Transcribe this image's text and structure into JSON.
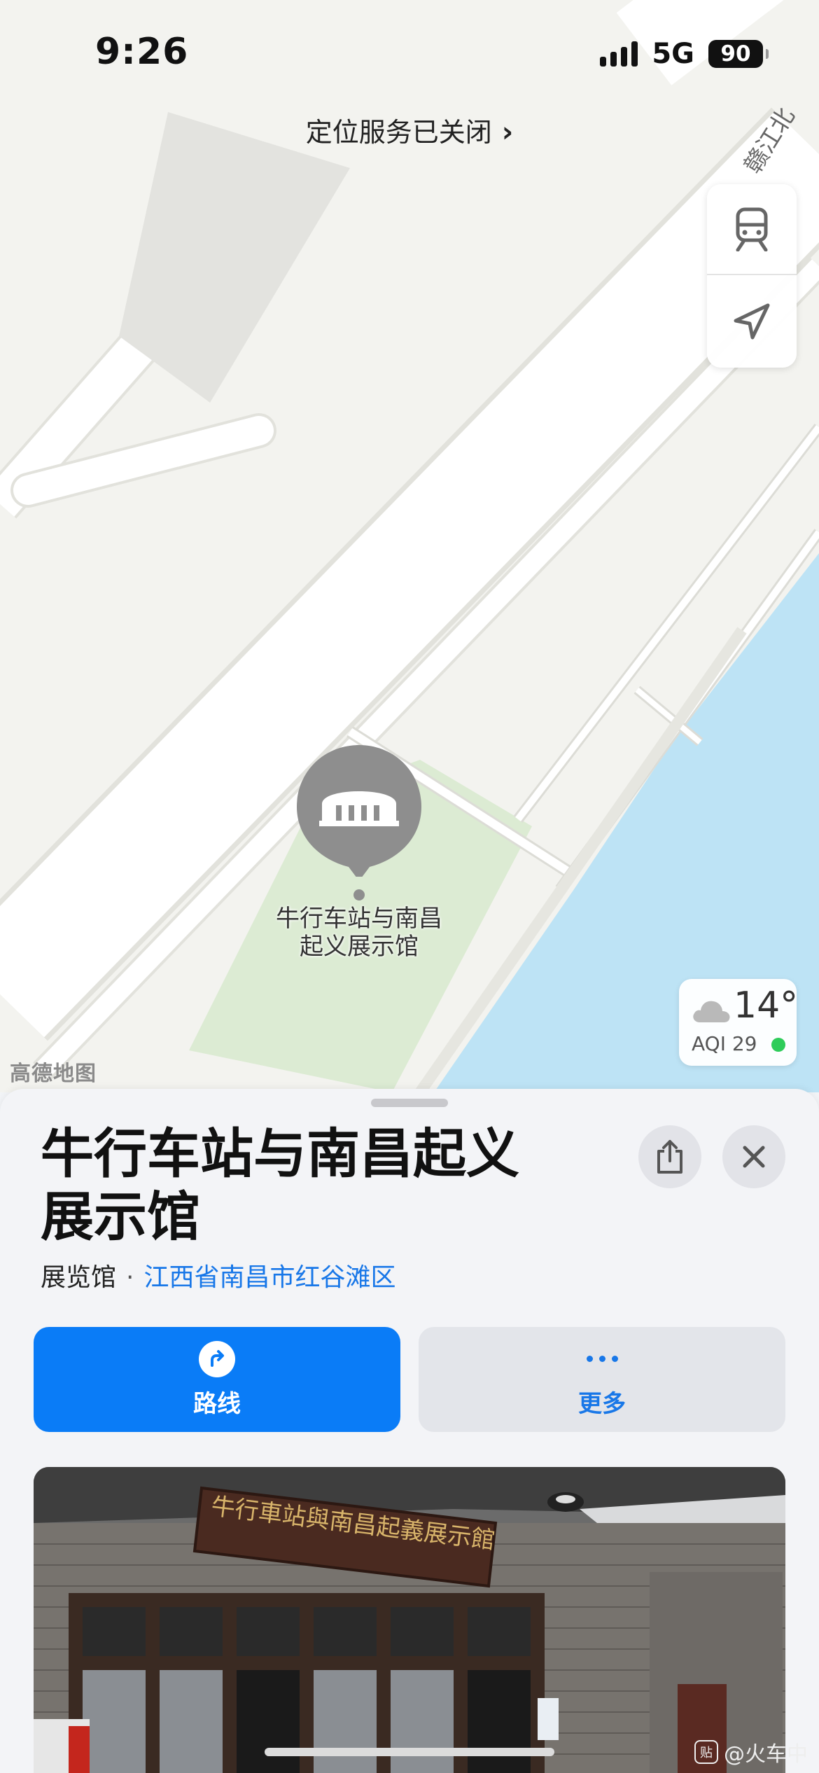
{
  "status_bar": {
    "time": "9:26",
    "network": "5G",
    "battery": "90"
  },
  "map": {
    "location_banner": "定位服务已关闭",
    "road_label": "赣江北",
    "pin_label": "牛行车站与南昌起义展示馆",
    "weather": {
      "temperature": "14°",
      "aqi": "AQI 29"
    },
    "attribution": "高德地图",
    "controls": {
      "transit_icon": "train-icon",
      "locate_icon": "location-arrow-icon"
    }
  },
  "place": {
    "title": "牛行车站与南昌起义展示馆",
    "category": "展览馆",
    "separator": "·",
    "region": "江西省南昌市红谷滩区",
    "actions": {
      "route_label": "路线",
      "more_label": "更多"
    },
    "photo_sign": "牛行車站與南昌起義展示館"
  },
  "watermark": {
    "badge": "贴",
    "text": "@火车中"
  },
  "colors": {
    "accent": "#0a7cf7",
    "water": "#bde3f5",
    "park": "#dcebd3"
  }
}
